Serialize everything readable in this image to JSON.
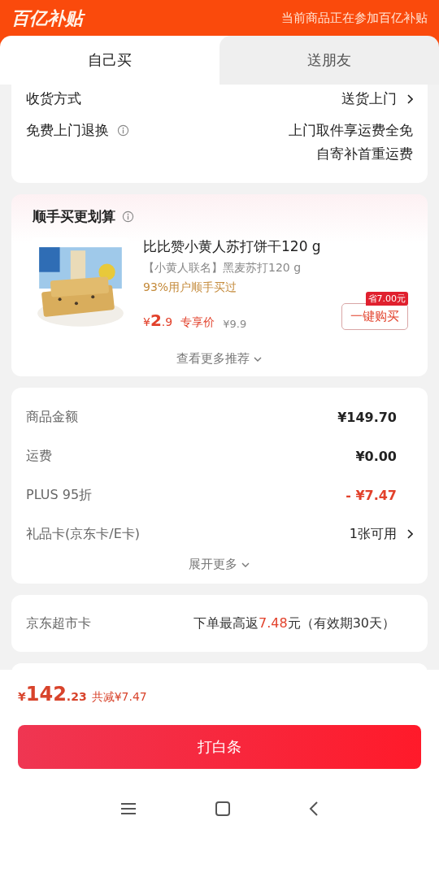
{
  "header": {
    "logo": "百亿补贴",
    "notice": "当前商品正在参加百亿补贴"
  },
  "tabs": [
    {
      "label": "自己买",
      "selected": true
    },
    {
      "label": "送朋友",
      "selected": false
    }
  ],
  "delivery": [
    {
      "label": "收货方式",
      "values": [
        "送货上门"
      ],
      "info": false,
      "chevron": true
    },
    {
      "label": "免费上门退换",
      "values": [
        "上门取件享运费全免",
        "自寄补首重运费"
      ],
      "info": true,
      "chevron": false
    }
  ],
  "addon": {
    "title": "顺手买更划算",
    "product": {
      "kind": "picture",
      "name": "比比赞小黄人苏打饼干120 g",
      "subtitle": "【小黄人联名】黑麦苏打120 g",
      "social": "93%用户顺手买过",
      "currency": "¥",
      "price_int": "2",
      "price_dec": ".9",
      "price_label": "专享价",
      "original_price": "¥9.9",
      "save_badge": "省7.00元",
      "buy_button": "一键购买"
    },
    "more": "查看更多推荐"
  },
  "summary": {
    "rows": [
      {
        "label": "商品金额",
        "value": "¥149.70",
        "kind": "plain"
      },
      {
        "label": "运费",
        "value": "¥0.00",
        "kind": "plain"
      },
      {
        "label": "PLUS 95折",
        "value": "- ¥7.47",
        "kind": "discount"
      },
      {
        "label": "礼品卡(京东卡/E卡)",
        "value": "1张可用",
        "kind": "link"
      }
    ],
    "expand": "展开更多"
  },
  "supermarket_card": {
    "label": "京东超市卡",
    "prefix": "下单最高返",
    "amount": "7.48",
    "suffix": "元（有效期30天）"
  },
  "footer": {
    "currency": "¥",
    "total_int": "142",
    "total_dec": ".23",
    "saving": "共减¥7.47",
    "pay_button": "打白条"
  }
}
